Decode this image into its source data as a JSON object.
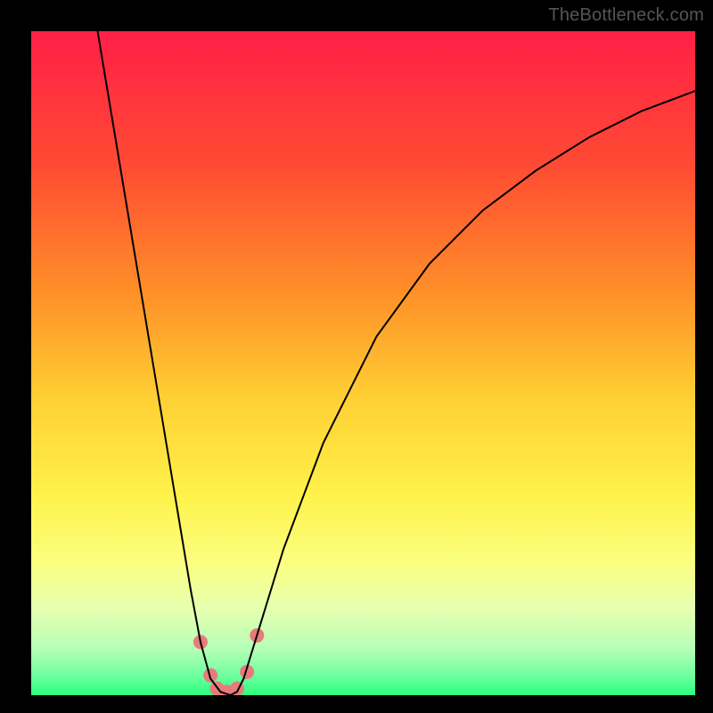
{
  "watermark": "TheBottleneck.com",
  "chart_data": {
    "type": "line",
    "title": "",
    "xlabel": "",
    "ylabel": "",
    "xlim": [
      0,
      100
    ],
    "ylim": [
      0,
      100
    ],
    "grid": false,
    "background_gradient": {
      "stops": [
        {
          "offset": 0.0,
          "color": "#ff1f47"
        },
        {
          "offset": 0.2,
          "color": "#ff4a33"
        },
        {
          "offset": 0.4,
          "color": "#ff9228"
        },
        {
          "offset": 0.55,
          "color": "#ffcf33"
        },
        {
          "offset": 0.7,
          "color": "#fff24a"
        },
        {
          "offset": 0.8,
          "color": "#fbff80"
        },
        {
          "offset": 0.87,
          "color": "#e6ffb0"
        },
        {
          "offset": 0.93,
          "color": "#b6ffb6"
        },
        {
          "offset": 0.97,
          "color": "#6fff9f"
        },
        {
          "offset": 1.0,
          "color": "#2bff7e"
        }
      ]
    },
    "series": [
      {
        "name": "curve",
        "color": "#000000",
        "stroke_width": 2,
        "x": [
          10,
          12,
          14,
          16,
          18,
          20,
          22,
          24,
          25.5,
          27,
          28.5,
          30,
          31,
          32,
          34,
          38,
          44,
          52,
          60,
          68,
          76,
          84,
          92,
          100
        ],
        "y": [
          100,
          88,
          76,
          64,
          52,
          40,
          28,
          16,
          8,
          2.5,
          0.5,
          0,
          0.5,
          2.5,
          9,
          22,
          38,
          54,
          65,
          73,
          79,
          84,
          88,
          91
        ]
      }
    ],
    "markers": {
      "name": "bottom-cluster",
      "color": "#e77b7b",
      "radius": 8,
      "points": [
        {
          "x": 25.5,
          "y": 8
        },
        {
          "x": 27.0,
          "y": 3
        },
        {
          "x": 28.0,
          "y": 1
        },
        {
          "x": 29.5,
          "y": 0.5
        },
        {
          "x": 31.0,
          "y": 1
        },
        {
          "x": 32.5,
          "y": 3.5
        },
        {
          "x": 34.0,
          "y": 9
        }
      ]
    }
  }
}
